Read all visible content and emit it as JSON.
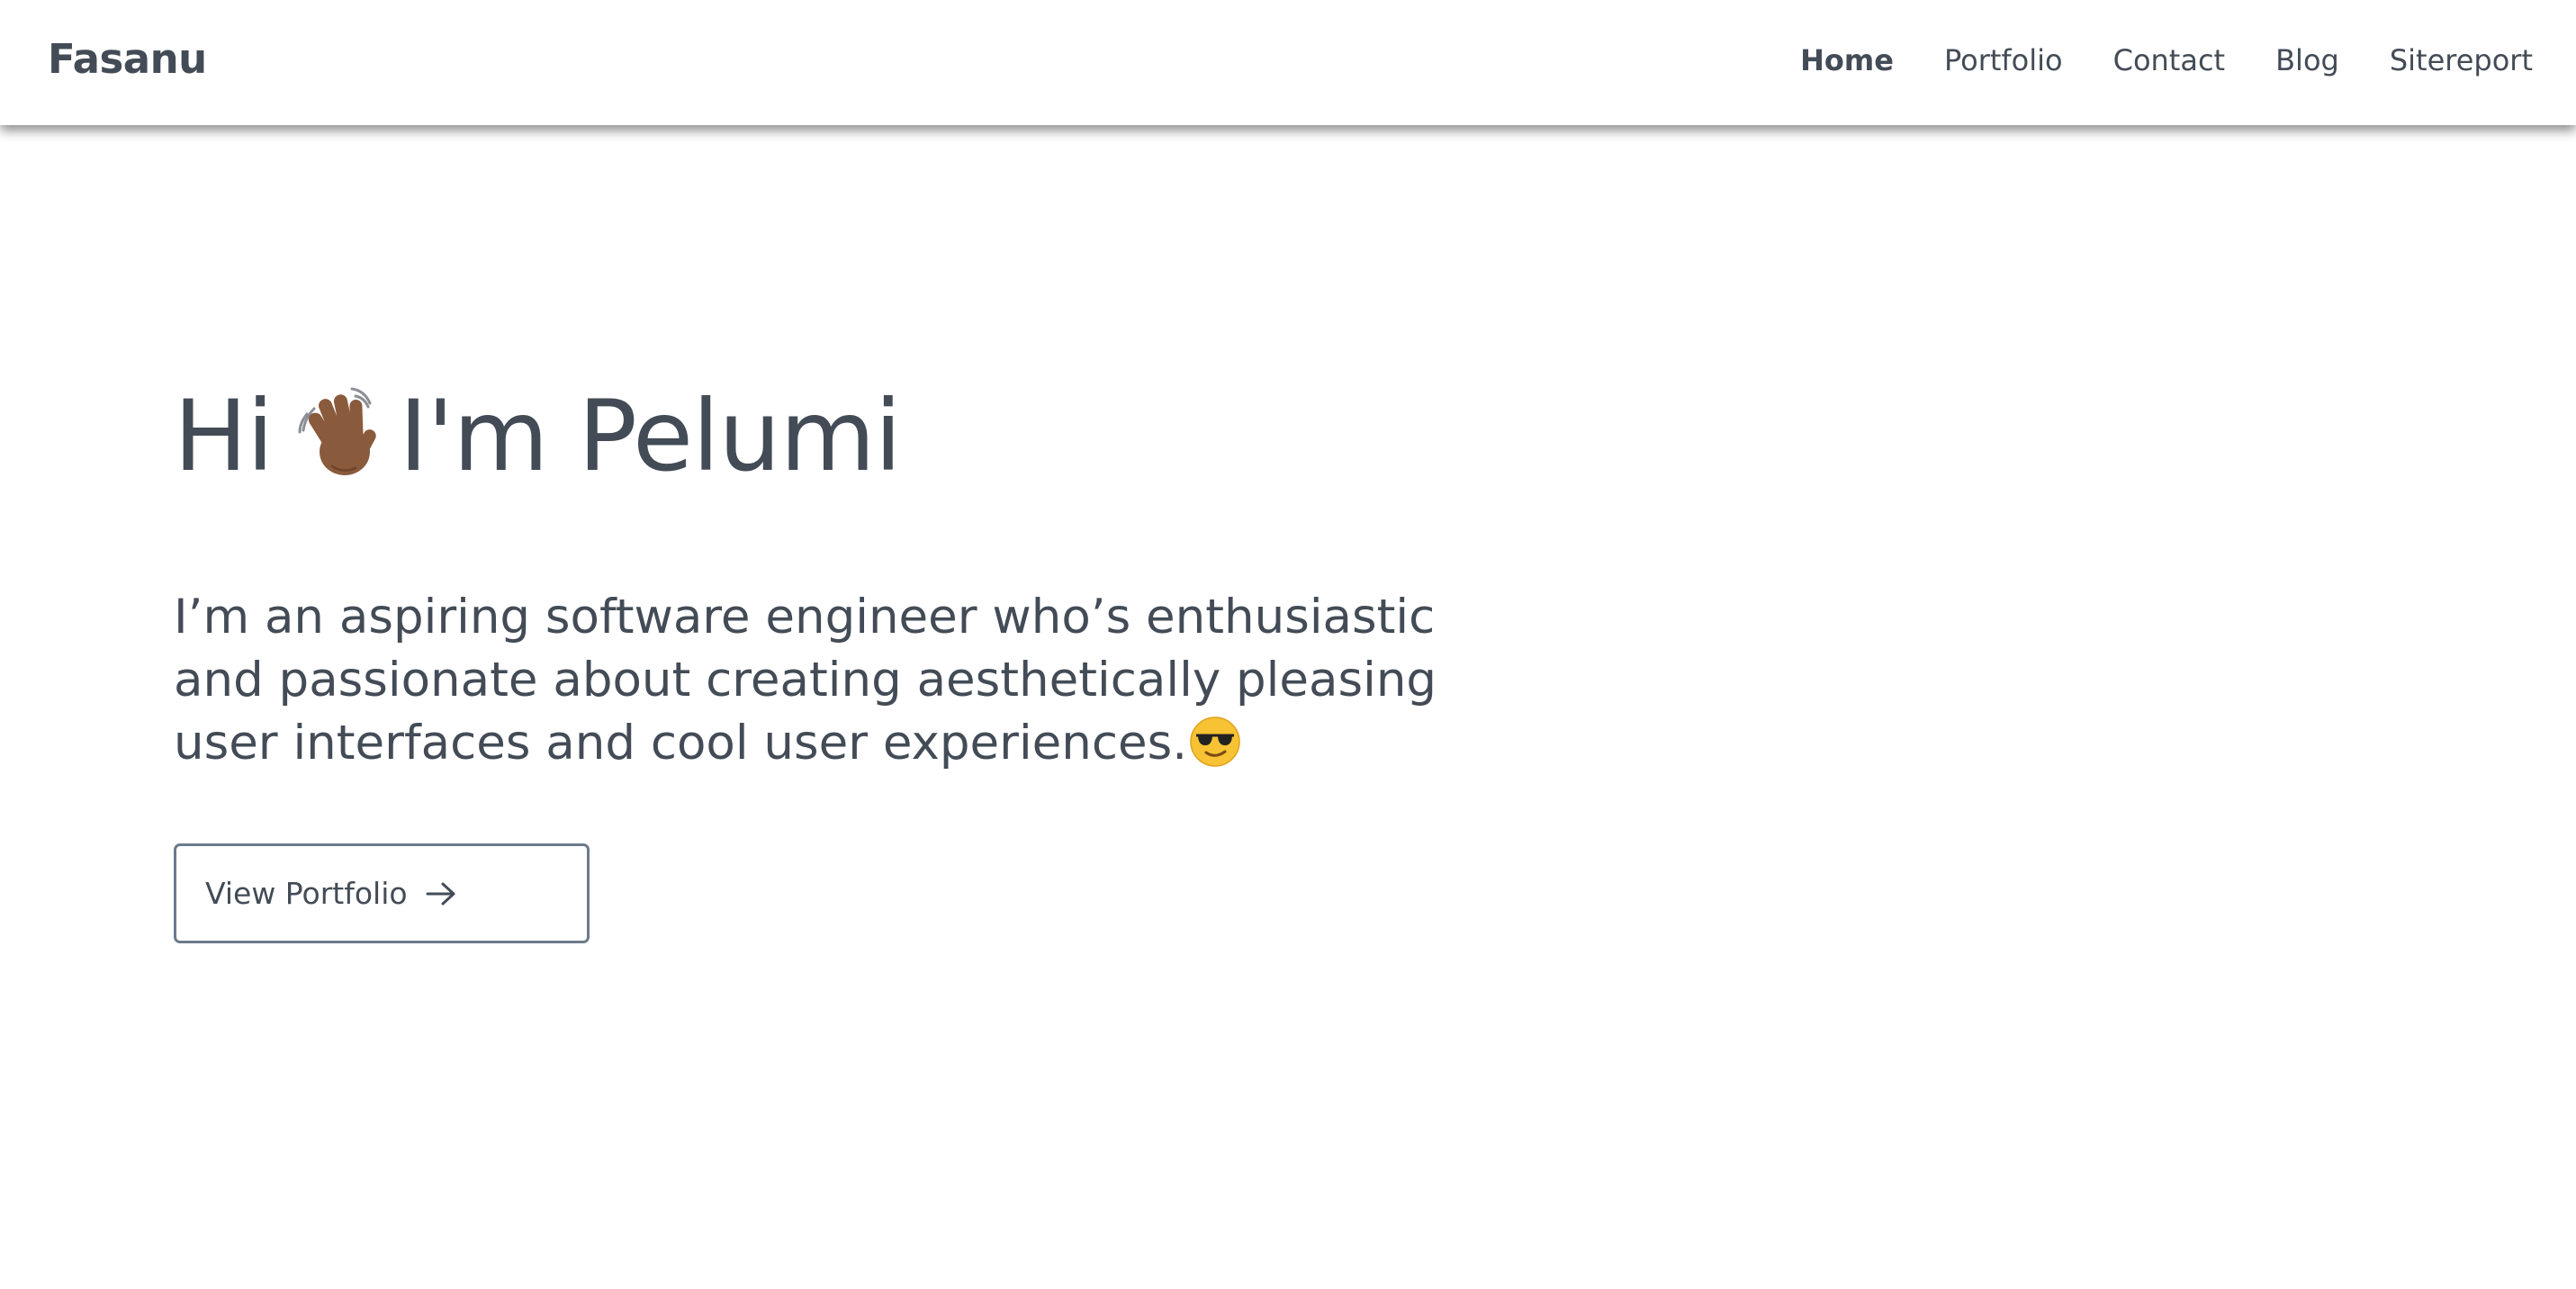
{
  "brand": "Fasanu",
  "nav": {
    "items": [
      "Home",
      "Portfolio",
      "Contact",
      "Blog",
      "Sitereport"
    ],
    "active": "Home"
  },
  "hero": {
    "title_before": "Hi",
    "title_after": "I'm Pelumi",
    "title_icon": "waving-hand-emoji",
    "description": "I’m an aspiring software engineer who’s enthusiastic and passionate about creating aesthetically pleasing user interfaces and cool user experiences.",
    "description_icon": "sunglasses-emoji",
    "cta_label": "View Portfolio",
    "cta_icon": "arrow-right-icon"
  },
  "colors": {
    "text": "#434c56",
    "button_border": "#6b7b8c",
    "background": "#ffffff"
  }
}
